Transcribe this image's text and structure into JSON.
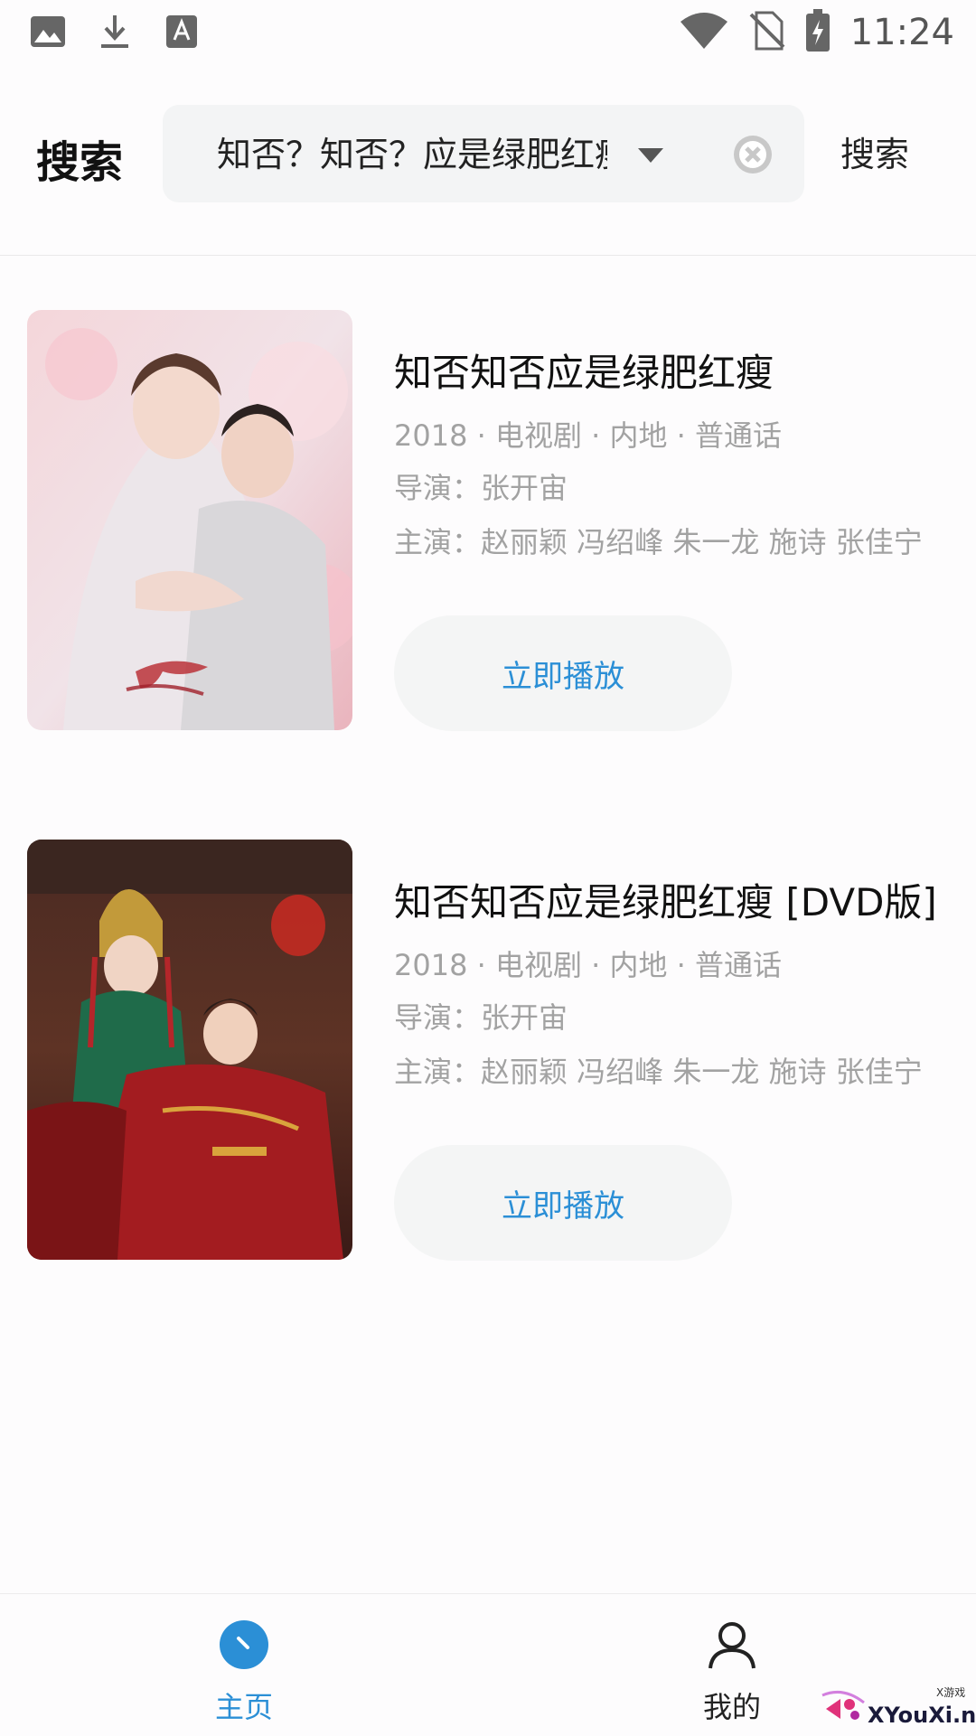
{
  "status_bar": {
    "time": "11:24",
    "left_icons": [
      "image-icon",
      "download-icon",
      "text-icon"
    ],
    "right_icons": [
      "wifi-icon",
      "no-sim-icon",
      "battery-charging-icon"
    ]
  },
  "header": {
    "title": "搜索",
    "search_value": "知否？知否？应是绿肥红瘦",
    "search_button": "搜索"
  },
  "results": [
    {
      "title": "知否知否应是绿肥红瘦",
      "meta": "2018 · 电视剧 · 内地 · 普通话",
      "director": "导演：张开宙",
      "cast": "主演：赵丽颖 冯绍峰 朱一龙 施诗 张佳宁",
      "play_label": "立即播放"
    },
    {
      "title": "知否知否应是绿肥红瘦 [DVD版]",
      "meta": "2018 · 电视剧 · 内地 · 普通话",
      "director": "导演：张开宙",
      "cast": "主演：赵丽颖 冯绍峰 朱一龙 施诗 张佳宁",
      "play_label": "立即播放"
    }
  ],
  "bottom_nav": {
    "home_label": "主页",
    "mine_label": "我的"
  },
  "watermark": {
    "text": "XYouXi.net",
    "small": "X游戏"
  },
  "colors": {
    "accent": "#2b8fd6",
    "muted_text": "#a2a2a2",
    "search_bg": "#f3f4f5"
  }
}
